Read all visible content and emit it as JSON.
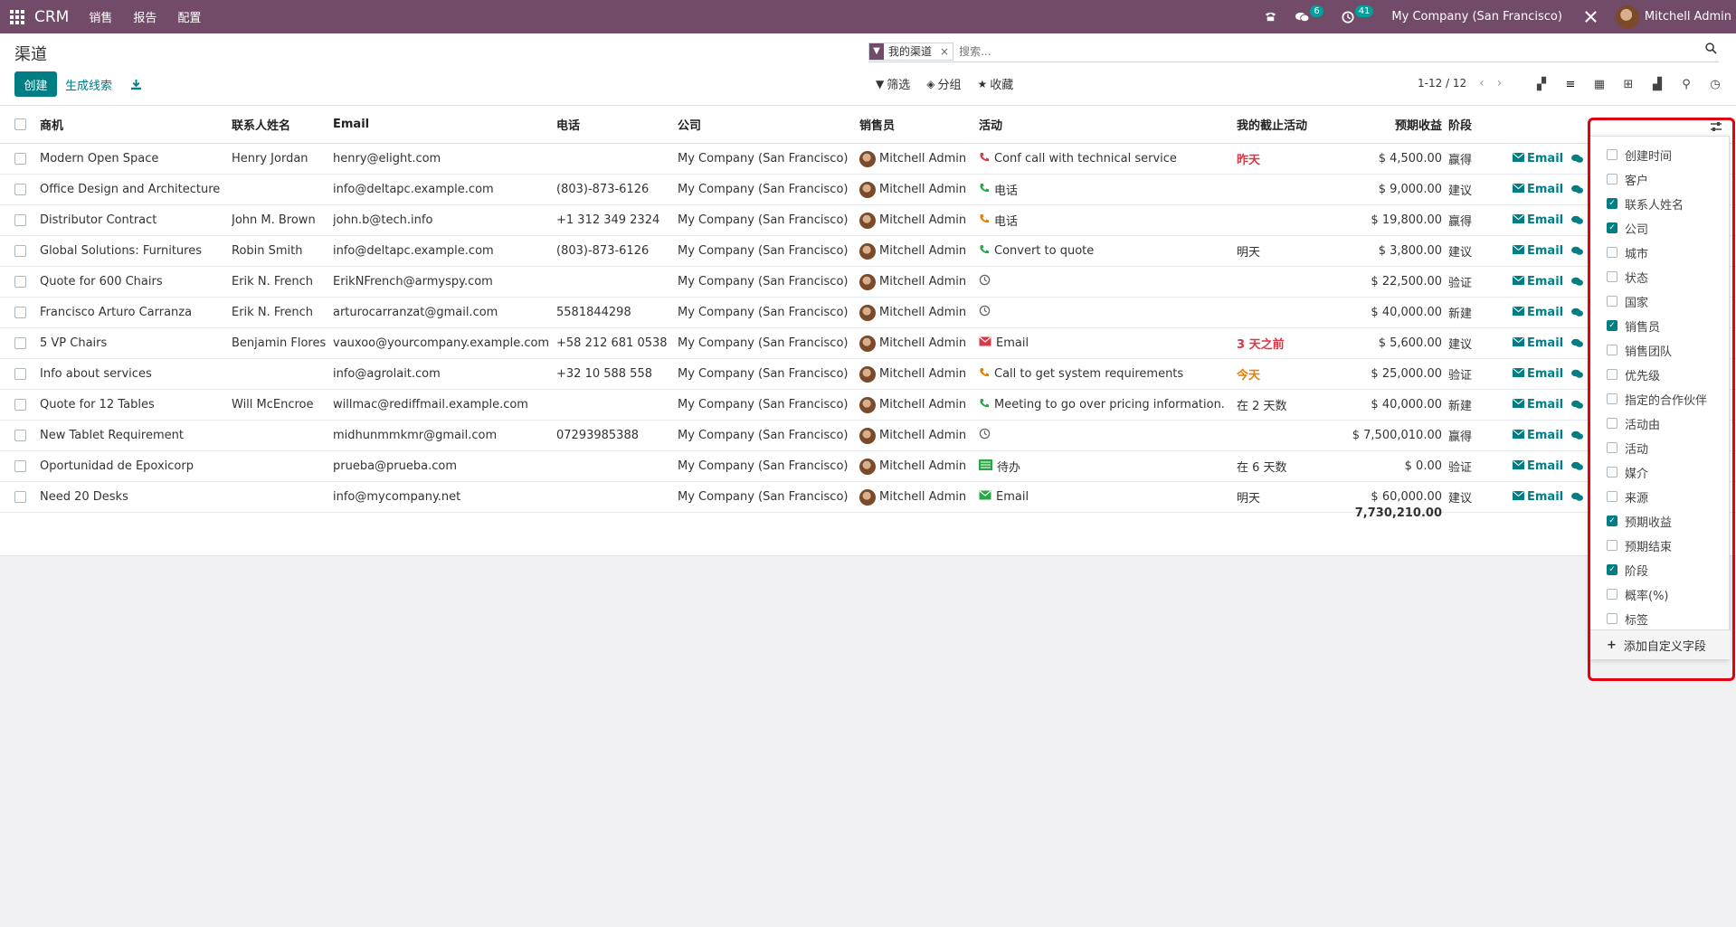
{
  "navbar": {
    "brand": "CRM",
    "menus": [
      "销售",
      "报告",
      "配置"
    ],
    "messages_badge": "6",
    "activities_badge": "41",
    "company": "My Company (San Francisco)",
    "user": "Mitchell Admin"
  },
  "control_panel": {
    "breadcrumb": "渠道",
    "create_label": "创建",
    "generate_leads_label": "生成线索",
    "search": {
      "facet_value": "我的渠道",
      "facet_remove": "×",
      "placeholder": "搜索..."
    },
    "filter_label": "筛选",
    "group_label": "分组",
    "favorites_label": "收藏",
    "pager": "1-12 / 12",
    "views": [
      "kanban-icon",
      "list-icon",
      "calendar-icon",
      "pivot-icon",
      "graph-icon",
      "map-icon",
      "activity-icon"
    ]
  },
  "table": {
    "headers": {
      "opportunity": "商机",
      "contact": "联系人姓名",
      "email": "Email",
      "phone": "电话",
      "company": "公司",
      "salesperson": "销售员",
      "activity": "活动",
      "deadline": "我的截止活动",
      "revenue": "预期收益",
      "stage": "阶段"
    },
    "email_button_label": "Email",
    "rows": [
      {
        "opportunity": "Modern Open Space",
        "contact": "Henry Jordan",
        "email": "henry@elight.com",
        "phone": "",
        "company": "My Company (San Francisco)",
        "salesperson": "Mitchell Admin",
        "activity_icon": "phone-icon",
        "activity_color": "#dc3545",
        "activity": "Conf call with technical service",
        "deadline": "昨天",
        "deadline_color": "#dc3545",
        "revenue": "$ 4,500.00",
        "stage": "赢得"
      },
      {
        "opportunity": "Office Design and Architecture",
        "contact": "",
        "email": "info@deltapc.example.com",
        "phone": "(803)-873-6126",
        "company": "My Company (San Francisco)",
        "salesperson": "Mitchell Admin",
        "activity_icon": "phone-icon",
        "activity_color": "#28a745",
        "activity": "电话",
        "deadline": "",
        "deadline_color": "#333333",
        "revenue": "$ 9,000.00",
        "stage": "建议"
      },
      {
        "opportunity": "Distributor Contract",
        "contact": "John M. Brown",
        "email": "john.b@tech.info",
        "phone": "+1 312 349 2324",
        "company": "My Company (San Francisco)",
        "salesperson": "Mitchell Admin",
        "activity_icon": "phone-icon",
        "activity_color": "#e67e00",
        "activity": "电话",
        "deadline": "",
        "deadline_color": "#333333",
        "revenue": "$ 19,800.00",
        "stage": "赢得"
      },
      {
        "opportunity": "Global Solutions: Furnitures",
        "contact": "Robin Smith",
        "email": "info@deltapc.example.com",
        "phone": "(803)-873-6126",
        "company": "My Company (San Francisco)",
        "salesperson": "Mitchell Admin",
        "activity_icon": "phone-icon",
        "activity_color": "#28a745",
        "activity": "Convert to quote",
        "deadline": "明天",
        "deadline_color": "#333333",
        "revenue": "$ 3,800.00",
        "stage": "建议"
      },
      {
        "opportunity": "Quote for 600 Chairs",
        "contact": "Erik N. French",
        "email": "ErikNFrench@armyspy.com",
        "phone": "",
        "company": "My Company (San Francisco)",
        "salesperson": "Mitchell Admin",
        "activity_icon": "clock-icon",
        "activity_color": "#666666",
        "activity": "",
        "deadline": "",
        "deadline_color": "#333333",
        "revenue": "$ 22,500.00",
        "stage": "验证"
      },
      {
        "opportunity": "Francisco Arturo Carranza",
        "contact": "Erik N. French",
        "email": "arturocarranzat@gmail.com",
        "phone": "5581844298",
        "company": "My Company (San Francisco)",
        "salesperson": "Mitchell Admin",
        "activity_icon": "clock-icon",
        "activity_color": "#666666",
        "activity": "",
        "deadline": "",
        "deadline_color": "#333333",
        "revenue": "$ 40,000.00",
        "stage": "新建"
      },
      {
        "opportunity": "5 VP Chairs",
        "contact": "Benjamin Flores",
        "email": "vauxoo@yourcompany.example.com",
        "phone": "+58 212 681 0538",
        "company": "My Company (San Francisco)",
        "salesperson": "Mitchell Admin",
        "activity_icon": "envelope-icon",
        "activity_color": "#dc3545",
        "activity": "Email",
        "deadline": "3 天之前",
        "deadline_color": "#dc3545",
        "revenue": "$ 5,600.00",
        "stage": "建议"
      },
      {
        "opportunity": "Info about services",
        "contact": "",
        "email": "info@agrolait.com",
        "phone": "+32 10 588 558",
        "company": "My Company (San Francisco)",
        "salesperson": "Mitchell Admin",
        "activity_icon": "phone-icon",
        "activity_color": "#e67e00",
        "activity": "Call to get system requirements",
        "deadline": "今天",
        "deadline_color": "#e67e00",
        "revenue": "$ 25,000.00",
        "stage": "验证"
      },
      {
        "opportunity": "Quote for 12 Tables",
        "contact": "Will McEncroe",
        "email": "willmac@rediffmail.example.com",
        "phone": "",
        "company": "My Company (San Francisco)",
        "salesperson": "Mitchell Admin",
        "activity_icon": "phone-icon",
        "activity_color": "#28a745",
        "activity": "Meeting to go over pricing information.",
        "deadline": "在 2 天数",
        "deadline_color": "#333333",
        "revenue": "$ 40,000.00",
        "stage": "新建"
      },
      {
        "opportunity": "New Tablet Requirement",
        "contact": "",
        "email": "midhunmmkmr@gmail.com",
        "phone": "07293985388",
        "company": "My Company (San Francisco)",
        "salesperson": "Mitchell Admin",
        "activity_icon": "clock-icon",
        "activity_color": "#666666",
        "activity": "",
        "deadline": "",
        "deadline_color": "#333333",
        "revenue": "$ 7,500,010.00",
        "stage": "赢得"
      },
      {
        "opportunity": "Oportunidad de Epoxicorp",
        "contact": "",
        "email": "prueba@prueba.com",
        "phone": "",
        "company": "My Company (San Francisco)",
        "salesperson": "Mitchell Admin",
        "activity_icon": "todo-icon",
        "activity_color": "#28a745",
        "activity": "待办",
        "deadline": "在 6 天数",
        "deadline_color": "#333333",
        "revenue": "$ 0.00",
        "stage": "验证"
      },
      {
        "opportunity": "Need 20 Desks",
        "contact": "",
        "email": "info@mycompany.net",
        "phone": "",
        "company": "My Company (San Francisco)",
        "salesperson": "Mitchell Admin",
        "activity_icon": "envelope-icon",
        "activity_color": "#28a745",
        "activity": "Email",
        "deadline": "明天",
        "deadline_color": "#333333",
        "revenue": "$ 60,000.00",
        "stage": "建议"
      }
    ],
    "total_revenue": "7,730,210.00"
  },
  "optional_columns": {
    "items": [
      {
        "label": "创建时间",
        "checked": false
      },
      {
        "label": "客户",
        "checked": false
      },
      {
        "label": "联系人姓名",
        "checked": true
      },
      {
        "label": "公司",
        "checked": true
      },
      {
        "label": "城市",
        "checked": false
      },
      {
        "label": "状态",
        "checked": false
      },
      {
        "label": "国家",
        "checked": false
      },
      {
        "label": "销售员",
        "checked": true
      },
      {
        "label": "销售团队",
        "checked": false
      },
      {
        "label": "优先级",
        "checked": false
      },
      {
        "label": "指定的合作伙伴",
        "checked": false
      },
      {
        "label": "活动由",
        "checked": false
      },
      {
        "label": "活动",
        "checked": false
      },
      {
        "label": "媒介",
        "checked": false
      },
      {
        "label": "来源",
        "checked": false
      },
      {
        "label": "预期收益",
        "checked": true
      },
      {
        "label": "预期结束",
        "checked": false
      },
      {
        "label": "阶段",
        "checked": true
      },
      {
        "label": "概率(%)",
        "checked": false
      },
      {
        "label": "标签",
        "checked": false
      }
    ],
    "add_custom_field_label": "添加自定义字段"
  },
  "colors": {
    "navbar": "#714b67",
    "primary": "#017e84",
    "highlight": "#e3000f"
  }
}
